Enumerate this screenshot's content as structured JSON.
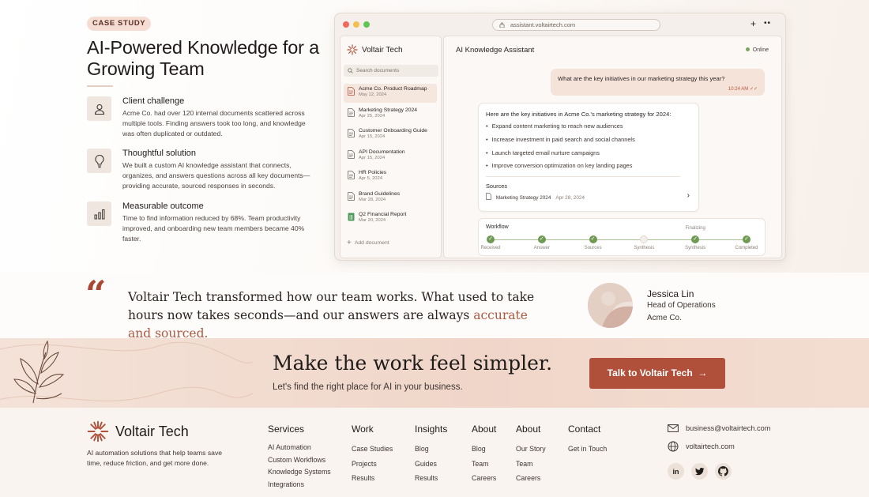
{
  "hero": {
    "badge": "CASE STUDY",
    "title": "AI-Powered Knowledge for a Growing Team",
    "features": [
      {
        "icon": "user-icon",
        "title": "Client challenge",
        "text": "Acme Co. had over 120 internal documents scattered across multiple tools. Finding answers took too long, and knowledge was often duplicated or outdated."
      },
      {
        "icon": "lightbulb-icon",
        "title": "Thoughtful solution",
        "text": "We built a custom AI knowledge assistant that connects, organizes, and answers questions across all key documents—providing accurate, sourced responses in seconds."
      },
      {
        "icon": "bar-chart-icon",
        "title": "Measurable outcome",
        "text": "Time to find information reduced by 68%. Team productivity improved, and onboarding new team members became 40% faster."
      }
    ]
  },
  "browser": {
    "url": "assistant.voltairtech.com",
    "plus": "+",
    "more": "••",
    "sidebar": {
      "brand": "Voltair Tech",
      "search_placeholder": "Search documents",
      "docs": [
        {
          "name": "Acme Co. Product Roadmap",
          "date": "May 12, 2024",
          "active": true,
          "kind": "doc"
        },
        {
          "name": "Marketing Strategy 2024",
          "date": "Apr 25, 2024",
          "active": false,
          "kind": "doc"
        },
        {
          "name": "Customer Onboarding Guide",
          "date": "Apr 15, 2024",
          "active": false,
          "kind": "doc"
        },
        {
          "name": "API Documentation",
          "date": "Apr 15, 2024",
          "active": false,
          "kind": "doc"
        },
        {
          "name": "HR Policies",
          "date": "Apr 5, 2024",
          "active": false,
          "kind": "doc"
        },
        {
          "name": "Brand Guidelines",
          "date": "Mar 28, 2024",
          "active": false,
          "kind": "doc"
        },
        {
          "name": "Q2 Financial Report",
          "date": "Mar 20, 2024",
          "active": false,
          "kind": "sheet"
        }
      ],
      "add_doc": "Add document"
    },
    "chat": {
      "title": "AI Knowledge Assistant",
      "status": "Online",
      "user_message": "What are the key initiatives in our marketing strategy this year?",
      "user_time": "10:24 AM",
      "ai_intro": "Here are the key initiatives in Acme Co.'s marketing strategy for 2024:",
      "ai_points": [
        "Expand content marketing to reach new audiences",
        "Increase investment in paid search and social channels",
        "Launch targeted email nurture campaigns",
        "Improve conversion optimization on key landing pages"
      ],
      "sources_label": "Sources",
      "source_name": "Marketing Strategy 2024",
      "source_date": "Apr 28, 2024",
      "workflow_label": "Workflow",
      "workflow_steps": [
        {
          "name": "Received",
          "done": true,
          "above": ""
        },
        {
          "name": "Answer",
          "done": true,
          "above": ""
        },
        {
          "name": "Sources",
          "done": true,
          "above": ""
        },
        {
          "name": "Synthesis",
          "done": false,
          "above": ""
        },
        {
          "name": "Synthesis",
          "done": true,
          "above": "Finalizing"
        },
        {
          "name": "Completed",
          "done": true,
          "above": ""
        }
      ]
    }
  },
  "testimonial": {
    "quote_mark": "“",
    "quote_main": "Voltair Tech transformed how our team works. What used to take hours now takes seconds—and our answers are always ",
    "quote_highlight": "accurate and sourced.",
    "name": "Jessica Lin",
    "role": "Head of Operations",
    "company": "Acme Co."
  },
  "cta": {
    "title": "Make the work feel simpler.",
    "subtitle": "Let's find the right place for AI in your business.",
    "button": "Talk to Voltair Tech",
    "button_arrow": "→"
  },
  "footer": {
    "brand": "Voltair Tech",
    "tagline": "AI automation solutions that help teams save time, reduce friction, and get more done.",
    "columns": [
      {
        "heading": "Services",
        "links": [
          "AI Automation",
          "Custom Workflows",
          "Knowledge Systems",
          "Integrations"
        ]
      },
      {
        "heading": "Work",
        "links": [
          "Case Studies",
          "Projects",
          "Results"
        ]
      },
      {
        "heading": "Insights",
        "links": [
          "Blog",
          "Guides",
          "Results"
        ]
      },
      {
        "heading": "About",
        "links": [
          "Blog",
          "Team",
          "Careers"
        ]
      },
      {
        "heading": "About",
        "links": [
          "Our Story",
          "Team",
          "Careers"
        ]
      },
      {
        "heading": "Contact",
        "links": [
          "Get in Touch"
        ]
      }
    ],
    "email": "business@voltairtech.com",
    "website": "voltairtech.com",
    "socials": [
      {
        "name": "linkedin",
        "glyph": "in"
      },
      {
        "name": "twitter",
        "glyph": ""
      },
      {
        "name": "github",
        "glyph": ""
      }
    ]
  },
  "colors": {
    "accent": "#b0503a",
    "online": "#7aa55f",
    "workflow_done": "#6e9a55"
  }
}
